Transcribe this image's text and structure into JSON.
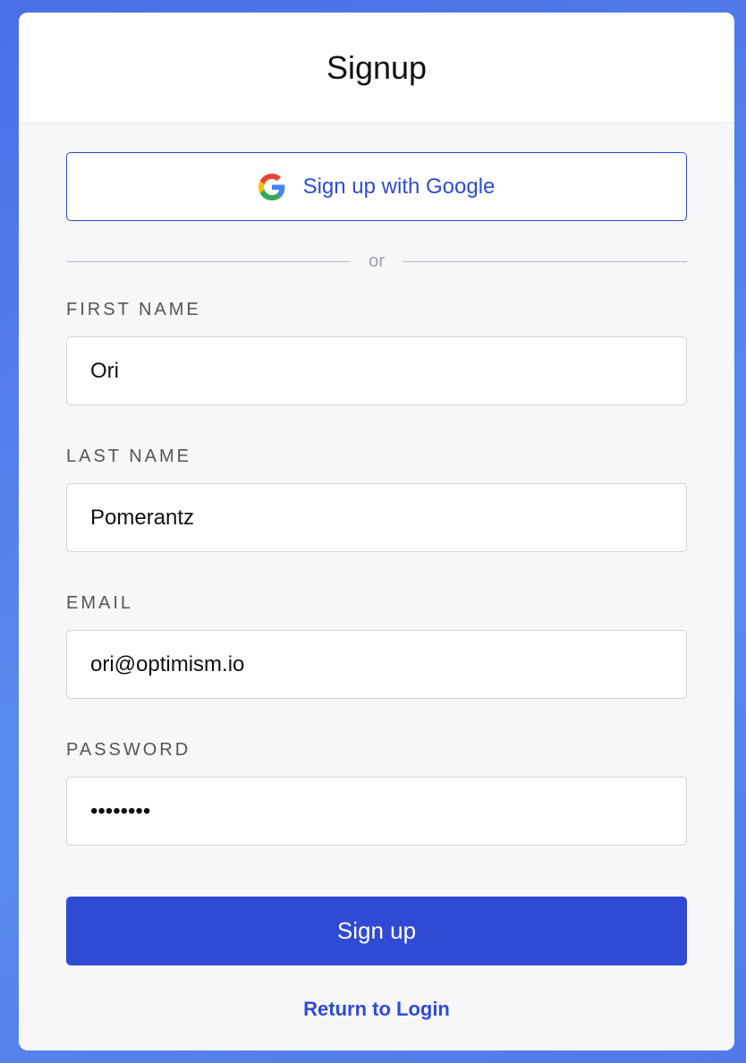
{
  "header": {
    "title": "Signup"
  },
  "google": {
    "label": "Sign up with Google"
  },
  "divider": {
    "text": "or"
  },
  "fields": {
    "first_name": {
      "label": "FIRST NAME",
      "value": "Ori"
    },
    "last_name": {
      "label": "LAST NAME",
      "value": "Pomerantz"
    },
    "email": {
      "label": "EMAIL",
      "value": "ori@optimism.io"
    },
    "password": {
      "label": "PASSWORD",
      "value": "••••••••"
    }
  },
  "actions": {
    "submit_label": "Sign up",
    "return_label": "Return to Login"
  },
  "colors": {
    "accent": "#2f4bd4",
    "background_gradient": "#4a6fe6"
  },
  "icons": {
    "google": "google-g-icon"
  }
}
